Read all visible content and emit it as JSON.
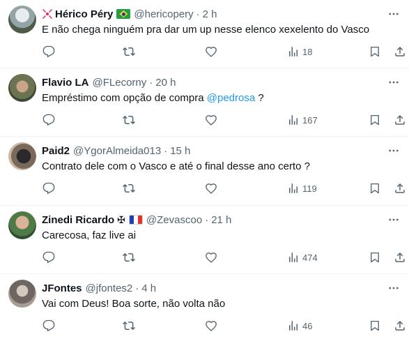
{
  "tweets": [
    {
      "name": "Hérico Péry",
      "handle": "@hericopery",
      "separator": "·",
      "time": "2 h",
      "text": "E não chega ninguém pra dar um up nesse elenco xexelento do Vasco",
      "views": "18",
      "badges": [
        "red-angry-emoji",
        "brazil-flag"
      ]
    },
    {
      "name": "Flavio LA",
      "handle": "@FLecorny",
      "separator": "·",
      "time": "20 h",
      "text_before": "Empréstimo com opção de compra ",
      "mention": "@pedrosa",
      "text_after": " ?",
      "views": "167"
    },
    {
      "name": "Paid2",
      "handle": "@YgorAlmeida013",
      "separator": "·",
      "time": "15 h",
      "text": "Contrato dele com o Vasco e até o final desse ano certo ?",
      "views": "119"
    },
    {
      "name": "Zinedi Ricardo",
      "cross": "✠",
      "handle": "@Zevascoo",
      "separator": "·",
      "time": "21 h",
      "text": "Carecosa, faz live ai",
      "views": "474",
      "badges": [
        "maltese-cross",
        "france-flag"
      ]
    },
    {
      "name": "JFontes",
      "handle": "@jfontes2",
      "separator": "·",
      "time": "4 h",
      "text": "Vai com Deus! Boa sorte, não volta não",
      "views": "46"
    }
  ],
  "icons": {
    "reply": "reply-icon",
    "retweet": "retweet-icon",
    "like": "like-icon",
    "views": "views-icon",
    "bookmark": "bookmark-icon",
    "share": "share-icon",
    "more": "more-icon"
  },
  "colors": {
    "text": "#0f1419",
    "secondary": "#536471",
    "link": "#1d9bf0",
    "divider": "#eff3f4"
  }
}
